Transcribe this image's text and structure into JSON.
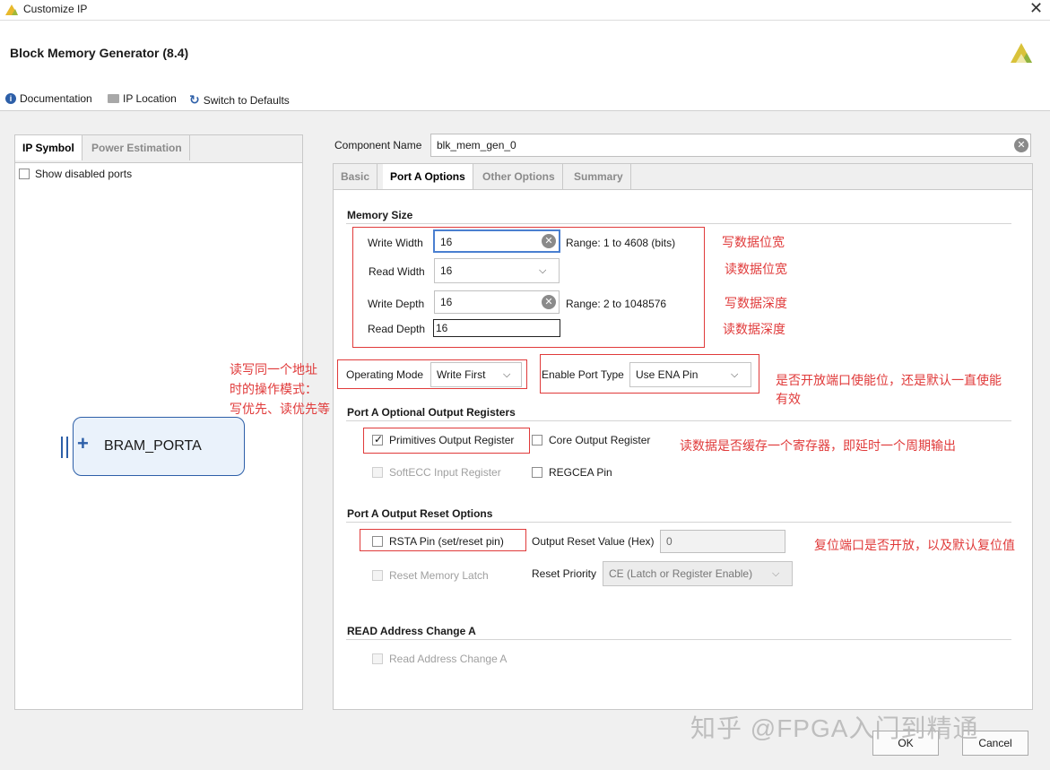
{
  "window": {
    "title": "Customize IP"
  },
  "header": {
    "title": "Block Memory Generator (8.4)",
    "toolbar": {
      "documentation": "Documentation",
      "ip_location": "IP Location",
      "switch_defaults": "Switch to Defaults"
    }
  },
  "left_panel": {
    "tabs": [
      "IP Symbol",
      "Power Estimation"
    ],
    "show_disabled_ports": "Show disabled ports",
    "symbol_label": "BRAM_PORTA"
  },
  "component": {
    "label": "Component Name",
    "value": "blk_mem_gen_0"
  },
  "right_tabs": [
    "Basic",
    "Port A Options",
    "Other Options",
    "Summary"
  ],
  "memory_size": {
    "title": "Memory Size",
    "write_width": {
      "label": "Write Width",
      "value": "16",
      "range": "Range: 1 to 4608 (bits)"
    },
    "read_width": {
      "label": "Read Width",
      "value": "16"
    },
    "write_depth": {
      "label": "Write Depth",
      "value": "16",
      "range": "Range: 2 to 1048576"
    },
    "read_depth": {
      "label": "Read Depth",
      "value": "16"
    }
  },
  "operating_mode": {
    "label": "Operating Mode",
    "value": "Write First"
  },
  "enable_port": {
    "label": "Enable Port Type",
    "value": "Use ENA Pin"
  },
  "optional_output": {
    "title": "Port A Optional Output Registers",
    "primitives": "Primitives Output Register",
    "core": "Core Output Register",
    "softecc": "SoftECC Input Register",
    "regcea": "REGCEA Pin"
  },
  "reset_options": {
    "title": "Port A Output Reset Options",
    "rsta": "RSTA Pin (set/reset pin)",
    "reset_value_label": "Output Reset Value (Hex)",
    "reset_value": "0",
    "reset_latch": "Reset Memory Latch",
    "priority_label": "Reset Priority",
    "priority_value": "CE (Latch or Register Enable)"
  },
  "read_address": {
    "title": "READ Address Change A",
    "item": "Read Address Change A"
  },
  "annotations": {
    "write_width": "写数据位宽",
    "read_width": "读数据位宽",
    "write_depth": "写数据深度",
    "read_depth": "读数据深度",
    "op_mode_1": "读写同一个地址",
    "op_mode_2": "时的操作模式：",
    "op_mode_3": "写优先、读优先等",
    "enable_1": "是否开放端口使能位，还是默认一直使能",
    "enable_2": "有效",
    "output_reg": "读数据是否缓存一个寄存器，即延时一个周期输出",
    "reset": "复位端口是否开放，以及默认复位值"
  },
  "buttons": {
    "ok": "OK",
    "cancel": "Cancel"
  },
  "watermark": "知乎 @FPGA入门到精通"
}
